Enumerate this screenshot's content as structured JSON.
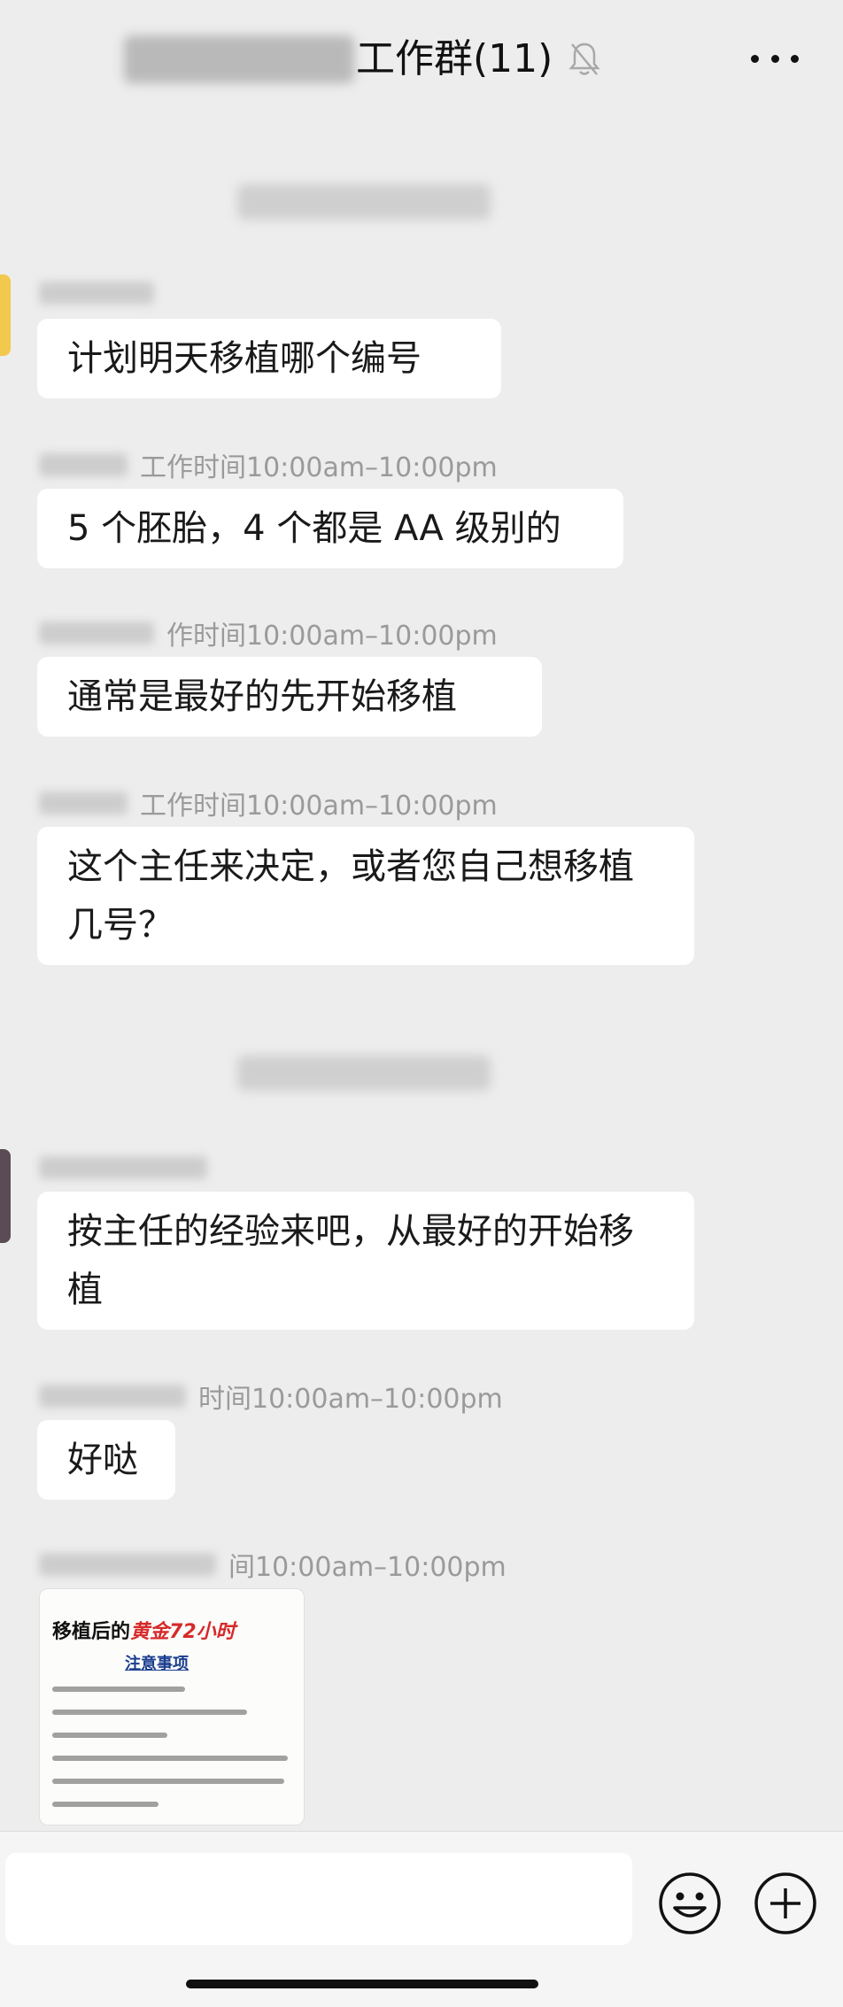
{
  "header": {
    "group_title": "工作群(11)",
    "mute_icon": "bell-slash-icon",
    "more_icon": "ellipsis-icon"
  },
  "messages": [
    {
      "text": "计划明天移植哪个编号",
      "sender_note": ""
    },
    {
      "text": "5 个胚胎，4 个都是 AA 级别的",
      "sender_note": "工作时间10:00am–10:00pm"
    },
    {
      "text": "通常是最好的先开始移植",
      "sender_note": "作时间10:00am–10:00pm"
    },
    {
      "text": "这个主任来决定，或者您自己想移植几号？",
      "sender_note": "工作时间10:00am–10:00pm"
    },
    {
      "text": "按主任的经验来吧，从最好的开始移植",
      "sender_note": ""
    },
    {
      "text": "好哒",
      "sender_note": "时间10:00am–10:00pm"
    }
  ],
  "image_message": {
    "sender_note": "间10:00am–10:00pm",
    "heading_black": "移植后的",
    "heading_red": "黄金72小时",
    "subheading": "注意事项"
  },
  "input_bar": {
    "emoji_icon": "smiley-face-icon",
    "plus_icon": "plus-circle-icon"
  },
  "colors": {
    "background": "#ededed",
    "bubble": "#ffffff",
    "meta_text": "#9a9a9a",
    "accent_red": "#d62a2a"
  }
}
